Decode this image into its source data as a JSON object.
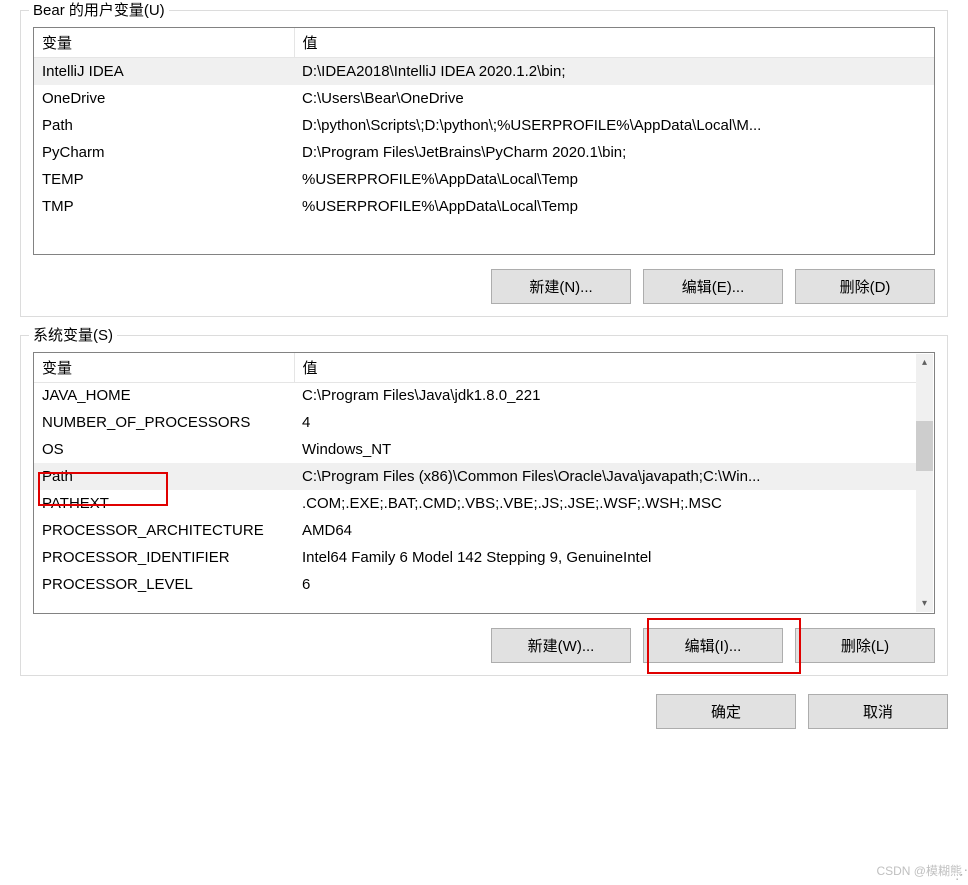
{
  "userGroup": {
    "title": "Bear 的用户变量(U)",
    "headers": {
      "var": "变量",
      "val": "值"
    },
    "rows": [
      {
        "var": "IntelliJ IDEA",
        "val": "D:\\IDEA2018\\IntelliJ IDEA 2020.1.2\\bin;",
        "selected": true
      },
      {
        "var": "OneDrive",
        "val": "C:\\Users\\Bear\\OneDrive"
      },
      {
        "var": "Path",
        "val": "D:\\python\\Scripts\\;D:\\python\\;%USERPROFILE%\\AppData\\Local\\M..."
      },
      {
        "var": "PyCharm",
        "val": "D:\\Program Files\\JetBrains\\PyCharm 2020.1\\bin;"
      },
      {
        "var": "TEMP",
        "val": "%USERPROFILE%\\AppData\\Local\\Temp"
      },
      {
        "var": "TMP",
        "val": "%USERPROFILE%\\AppData\\Local\\Temp"
      }
    ],
    "buttons": {
      "new": "新建(N)...",
      "edit": "编辑(E)...",
      "del": "删除(D)"
    }
  },
  "systemGroup": {
    "title": "系统变量(S)",
    "headers": {
      "var": "变量",
      "val": "值"
    },
    "rows": [
      {
        "var": "JAVA_HOME",
        "val": "C:\\Program Files\\Java\\jdk1.8.0_221"
      },
      {
        "var": "NUMBER_OF_PROCESSORS",
        "val": "4"
      },
      {
        "var": "OS",
        "val": "Windows_NT"
      },
      {
        "var": "Path",
        "val": "C:\\Program Files (x86)\\Common Files\\Oracle\\Java\\javapath;C:\\Win...",
        "selected": true,
        "highlight": true
      },
      {
        "var": "PATHEXT",
        "val": ".COM;.EXE;.BAT;.CMD;.VBS;.VBE;.JS;.JSE;.WSF;.WSH;.MSC"
      },
      {
        "var": "PROCESSOR_ARCHITECTURE",
        "val": "AMD64"
      },
      {
        "var": "PROCESSOR_IDENTIFIER",
        "val": "Intel64 Family 6 Model 142 Stepping 9, GenuineIntel"
      },
      {
        "var": "PROCESSOR_LEVEL",
        "val": "6"
      }
    ],
    "buttons": {
      "new": "新建(W)...",
      "edit": "编辑(I)...",
      "del": "删除(L)"
    }
  },
  "dialogButtons": {
    "ok": "确定",
    "cancel": "取消"
  },
  "watermark": "CSDN @模糊熊"
}
